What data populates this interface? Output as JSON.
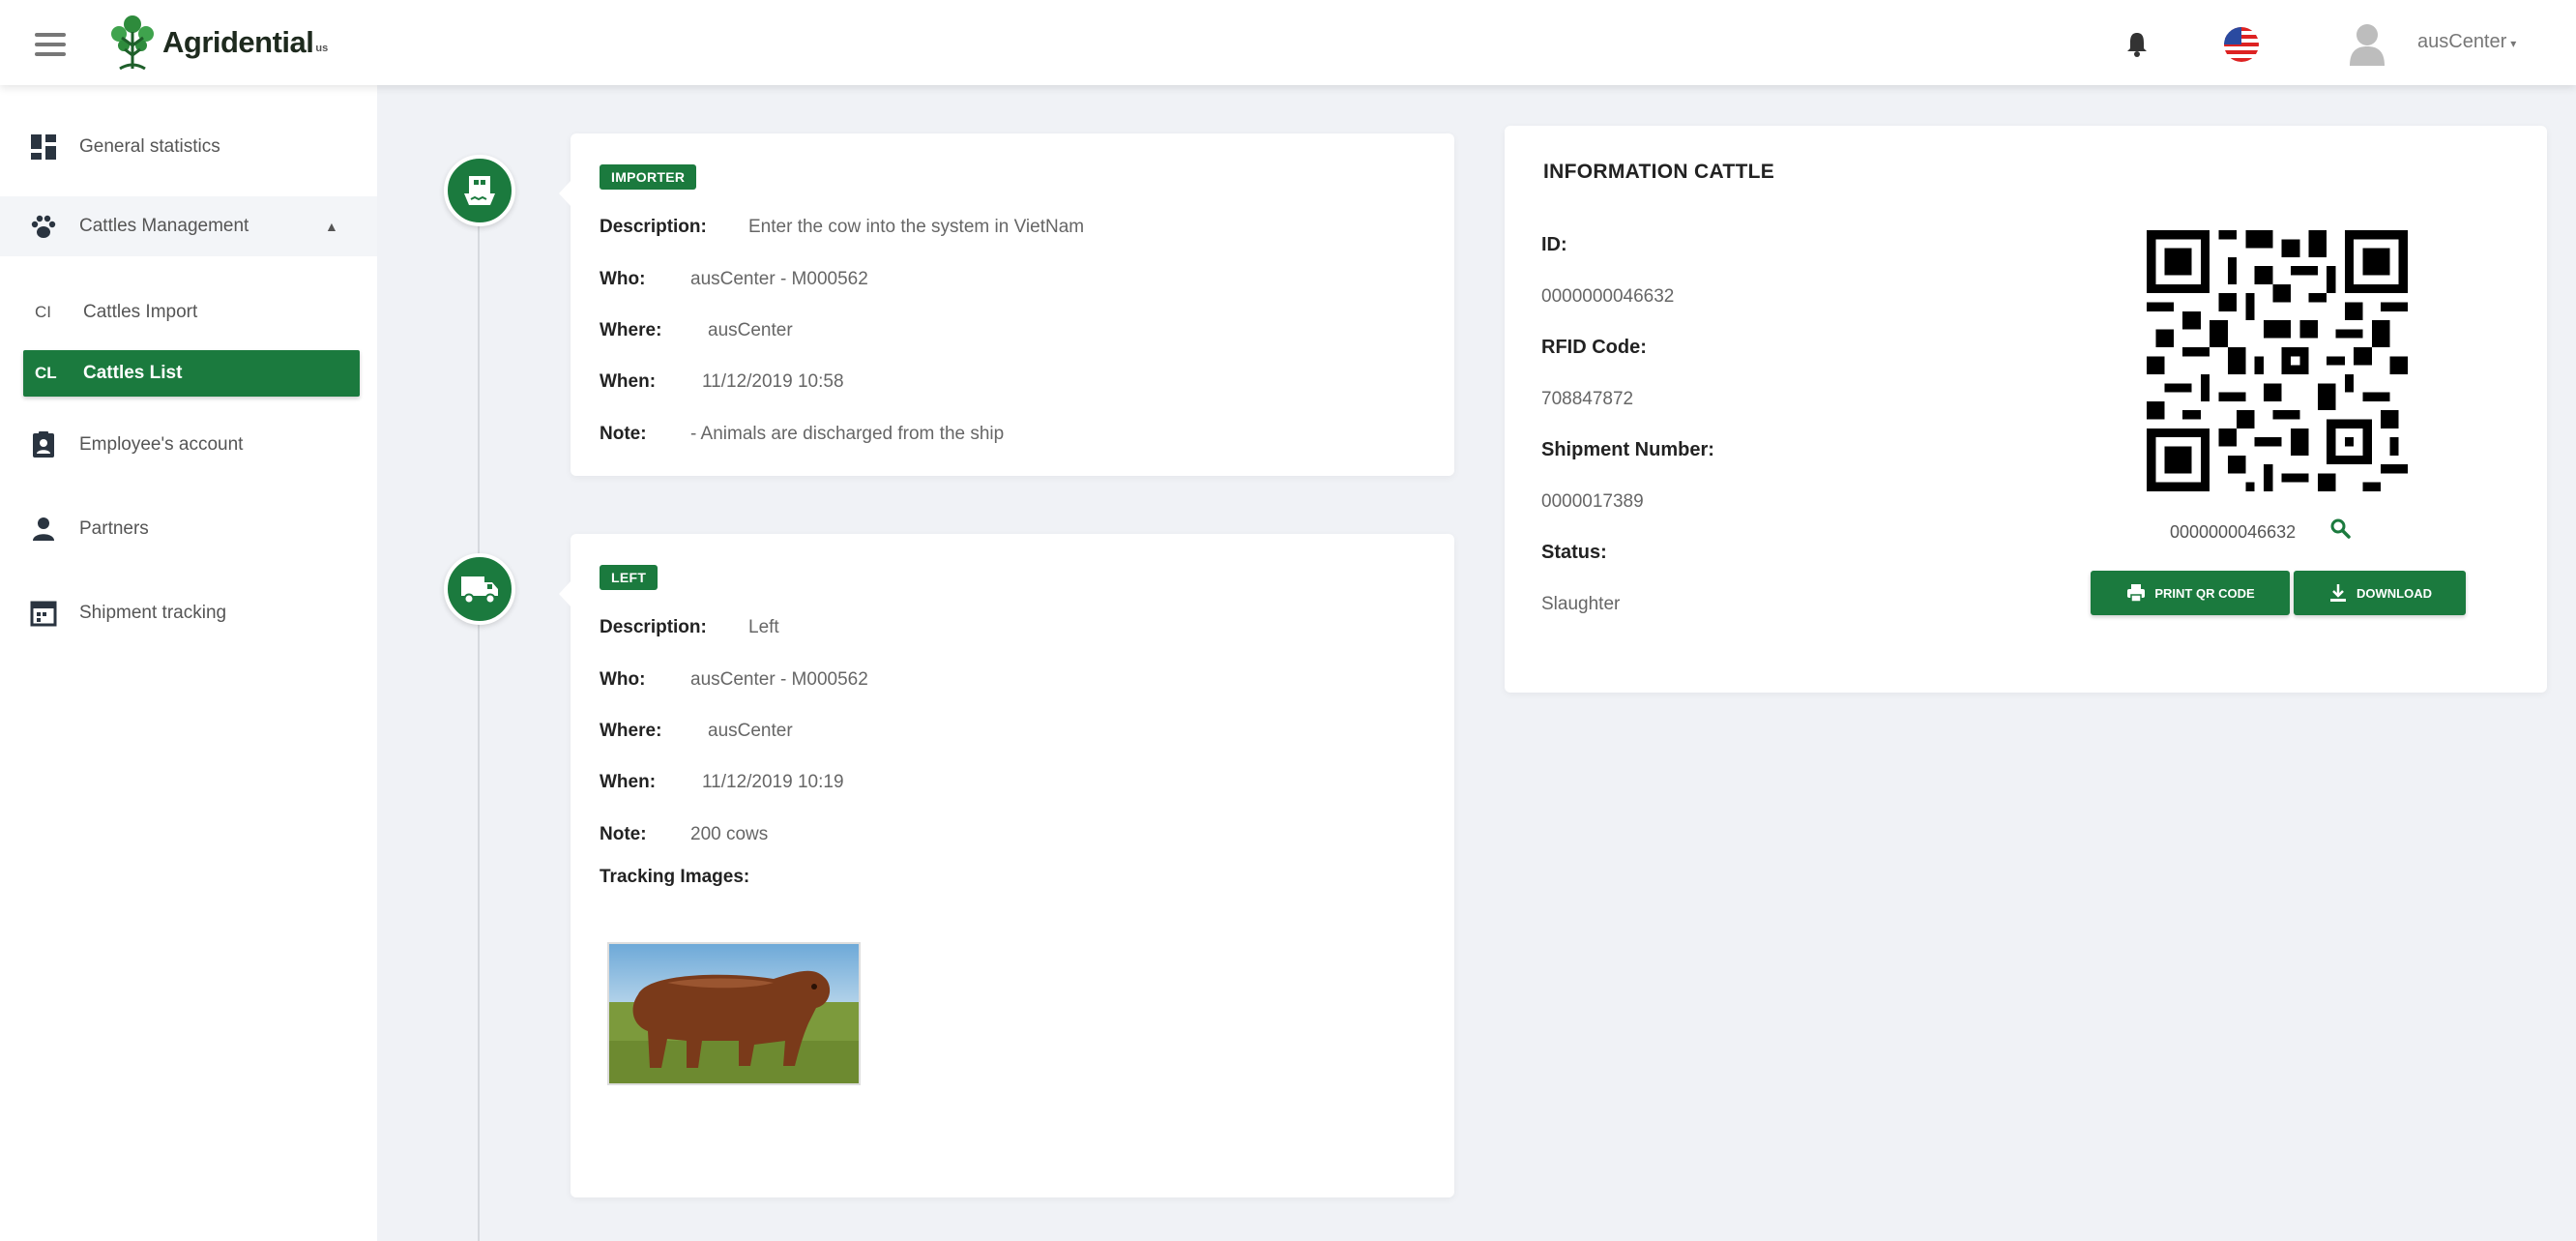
{
  "header": {
    "logo_text": "Agridential",
    "logo_suffix": "us",
    "user_name": "ausCenter"
  },
  "sidebar": {
    "items": [
      {
        "label": "General statistics",
        "icon": "dashboard-icon"
      },
      {
        "label": "Cattles Management",
        "icon": "paw-icon"
      },
      {
        "label": "Employee's account",
        "icon": "id-badge-icon"
      },
      {
        "label": "Partners",
        "icon": "person-icon"
      },
      {
        "label": "Shipment tracking",
        "icon": "calendar-icon"
      }
    ],
    "subitems": [
      {
        "abbr": "CI",
        "label": "Cattles Import"
      },
      {
        "abbr": "CL",
        "label": "Cattles List"
      }
    ]
  },
  "timeline": [
    {
      "badge": "IMPORTER",
      "icon": "ship-icon",
      "description_label": "Description:",
      "description": "Enter the cow into the system in VietNam",
      "who_label": "Who:",
      "who": "ausCenter - M000562",
      "where_label": "Where:",
      "where": "ausCenter",
      "when_label": "When:",
      "when": "11/12/2019 10:58",
      "note_label": "Note:",
      "note": "- Animals are discharged from the ship"
    },
    {
      "badge": "LEFT",
      "icon": "truck-icon",
      "description_label": "Description:",
      "description": "Left",
      "who_label": "Who:",
      "who": "ausCenter - M000562",
      "where_label": "Where:",
      "where": "ausCenter",
      "when_label": "When:",
      "when": "11/12/2019 10:19",
      "note_label": "Note:",
      "note": "200 cows",
      "images_label": "Tracking Images:"
    }
  ],
  "info": {
    "title": "INFORMATION CATTLE",
    "id_label": "ID:",
    "id": "0000000046632",
    "rfid_label": "RFID Code:",
    "rfid": "708847872",
    "shipment_label": "Shipment Number:",
    "shipment": "0000017389",
    "status_label": "Status:",
    "status": "Slaughter",
    "qr_text": "0000000046632",
    "print_label": "PRINT QR CODE",
    "download_label": "DOWNLOAD"
  },
  "colors": {
    "primary": "#1b7a3e",
    "background": "#f0f2f6"
  }
}
